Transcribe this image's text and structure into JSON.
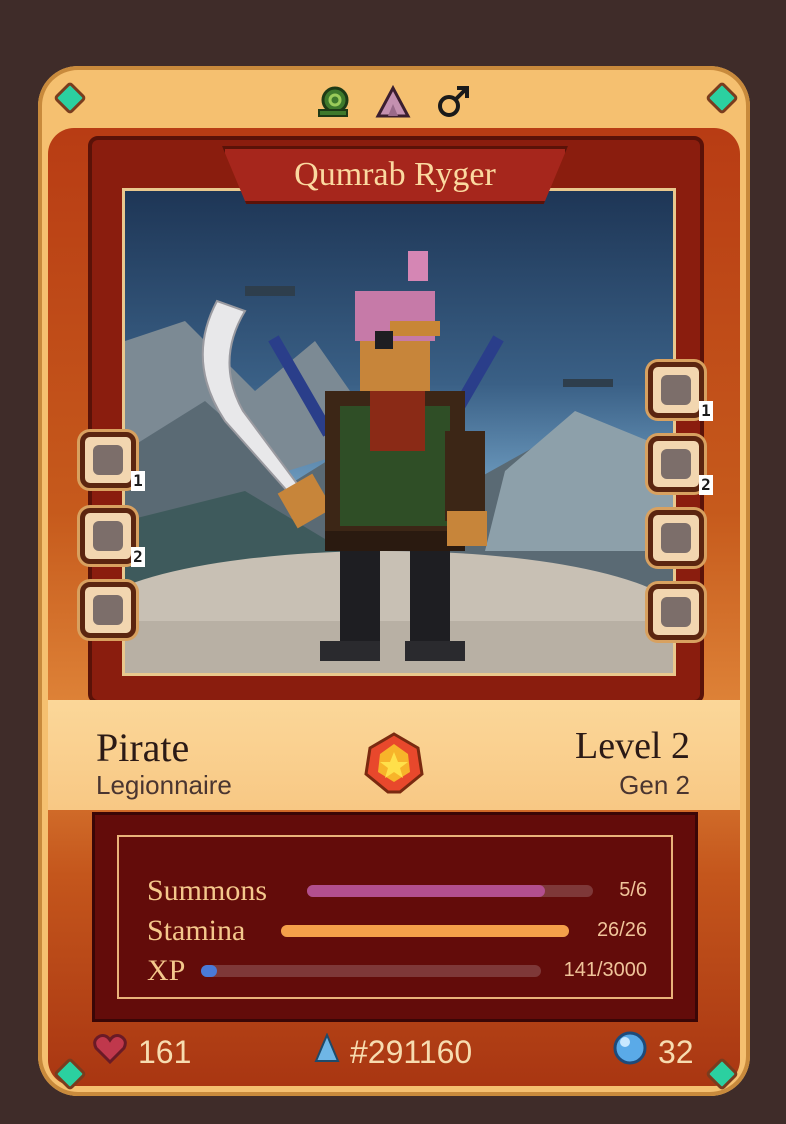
{
  "hero": {
    "name": "Qumrab Ryger",
    "class": "Pirate",
    "subclass": "Legionnaire",
    "level": "Level 2",
    "generation": "Gen 2"
  },
  "top_icons": [
    "snail-icon",
    "mountain-icon",
    "male-symbol-icon"
  ],
  "left_slots": [
    {
      "icon": "sword-skill-icon",
      "badge": "1"
    },
    {
      "icon": "sword-skill-icon",
      "badge": "2"
    },
    {
      "icon": "armor-icon",
      "badge": ""
    }
  ],
  "right_slots": [
    {
      "icon": "fist-skill-icon",
      "badge": "1"
    },
    {
      "icon": "fist-skill-icon",
      "badge": "2"
    },
    {
      "icon": "shield-skill-icon",
      "badge": ""
    },
    {
      "icon": "pet-icon",
      "badge": ""
    }
  ],
  "stats": {
    "summons": {
      "label": "Summons",
      "value": "5/6",
      "fraction": 0.833,
      "color": "#b24f8e"
    },
    "stamina": {
      "label": "Stamina",
      "value": "26/26",
      "fraction": 1.0,
      "color": "#f5a04a"
    },
    "xp": {
      "label": "XP",
      "value": "141/3000",
      "fraction": 0.047,
      "color": "#4a7ad8"
    }
  },
  "footer": {
    "hp": "161",
    "id": "#291160",
    "mp": "32"
  },
  "colors": {
    "accent_gem": "#2bd0a0",
    "card_border": "#f5c070",
    "stat_panel": "#630c0a"
  }
}
